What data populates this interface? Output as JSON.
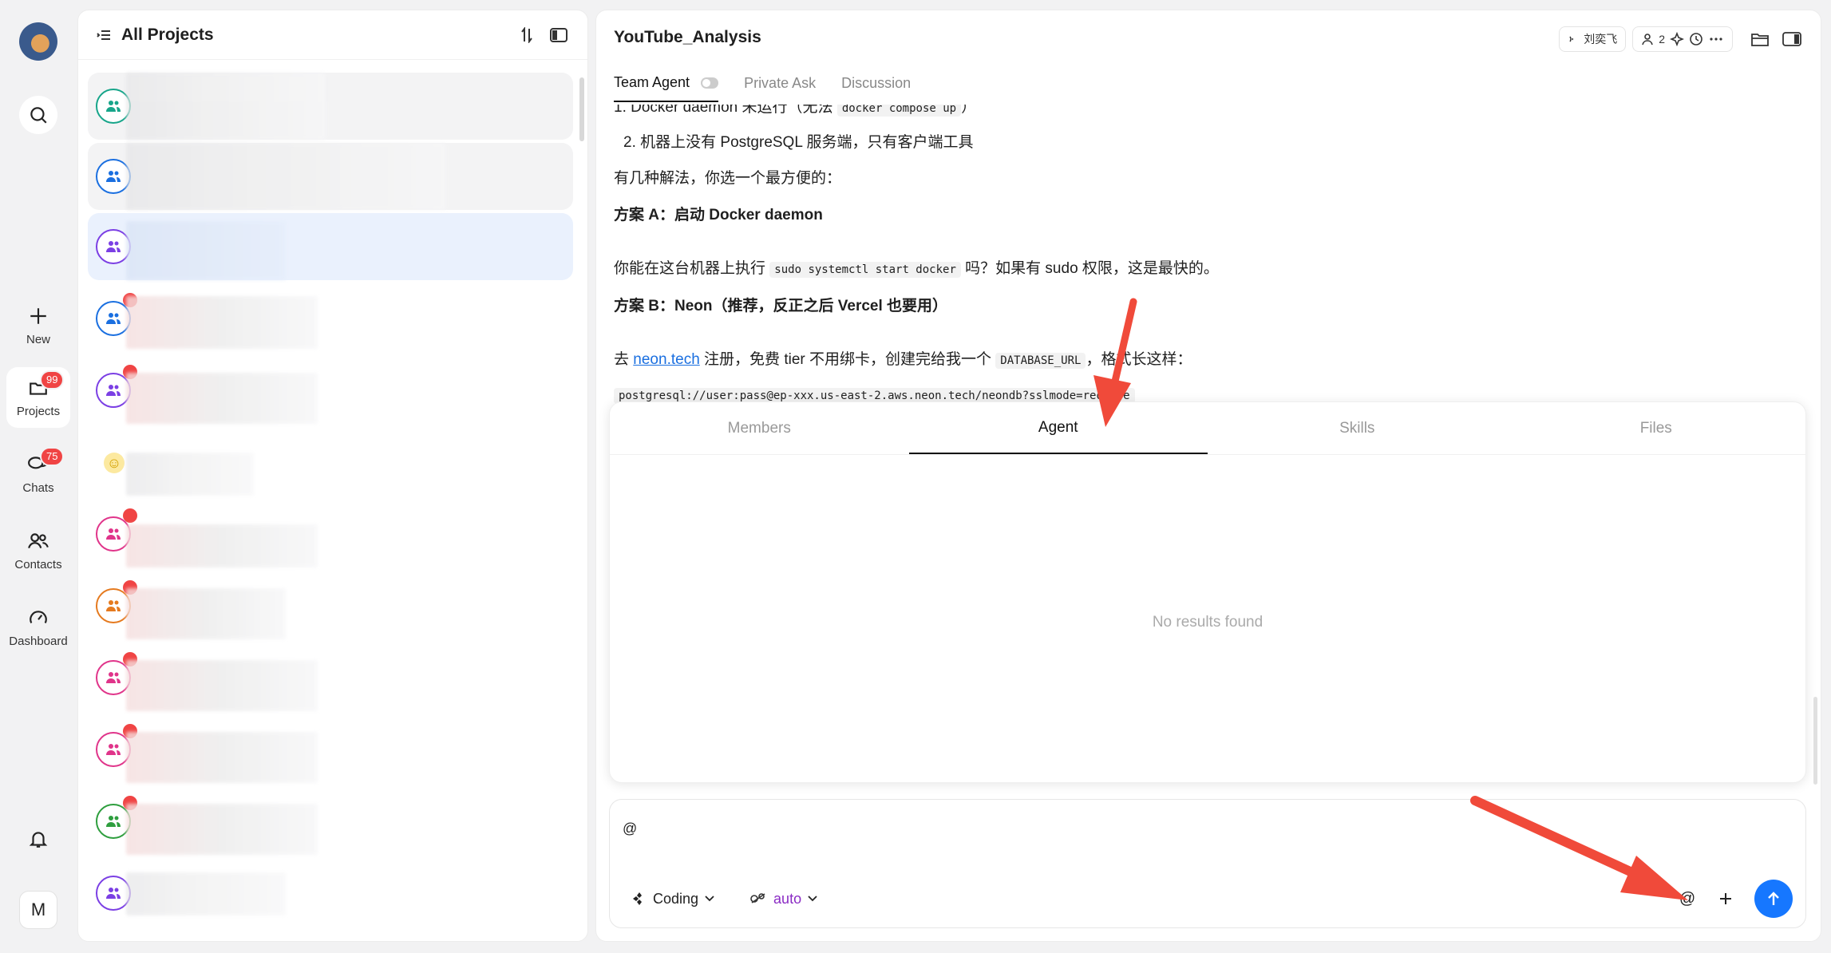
{
  "rail": {
    "items": [
      {
        "label": "New"
      },
      {
        "label": "Projects",
        "badge": "99"
      },
      {
        "label": "Chats",
        "badge": "75"
      },
      {
        "label": "Contacts"
      },
      {
        "label": "Dashboard"
      }
    ],
    "user_initial": "M"
  },
  "projects": {
    "title": "All Projects"
  },
  "main": {
    "title": "YouTube_Analysis",
    "member_name": "刘奕飞",
    "member_count": "2",
    "tabs": [
      "Team Agent",
      "Private Ask",
      "Discussion"
    ]
  },
  "chat": {
    "line1_prefix": "1. Docker daemon 未运行（无法",
    "line1_code": "docker compose up",
    "line1_suffix": "）",
    "line2": "2.  机器上没有 PostgreSQL 服务端，只有客户端工具",
    "line3": "有几种解法，你选一个最方便的：",
    "planA": "方案 A：启动 Docker daemon",
    "line5_prefix": "你能在这台机器上执行",
    "line5_code": "sudo systemctl start docker",
    "line5_suffix": "吗？如果有 sudo 权限，这是最快的。",
    "planB": "方案 B：Neon（推荐，反正之后 Vercel 也要用）",
    "line7_prefix": "去",
    "line7_link": "neon.tech",
    "line7_mid": "注册，免费 tier 不用绑卡，创建完给我一个",
    "line7_code": "DATABASE_URL",
    "line7_suffix": "，格式长这样：",
    "code_block": "postgresql://user:pass@ep-xxx.us-east-2.aws.neon.tech/neondb?sslmode=require"
  },
  "popover": {
    "tabs": [
      "Members",
      "Agent",
      "Skills",
      "Files"
    ],
    "active_tab": "Agent",
    "empty_text": "No results found"
  },
  "composer": {
    "text": "@",
    "mode": "Coding",
    "model": "auto"
  },
  "colors": {
    "accent": "#1677ff",
    "annotation_arrow": "#f04a3a"
  }
}
